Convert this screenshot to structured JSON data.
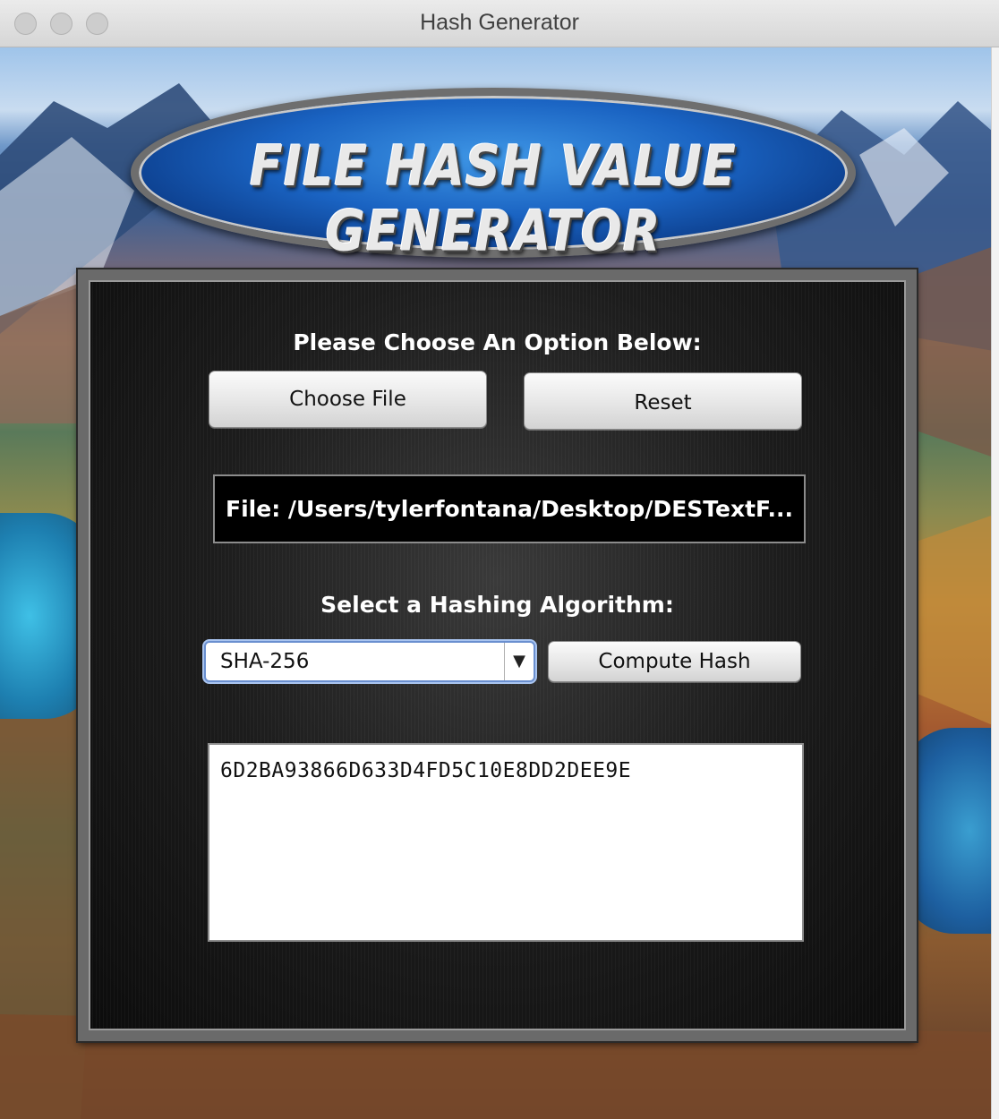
{
  "window": {
    "title": "Hash Generator"
  },
  "logo": {
    "text": "FILE HASH VALUE GENERATOR"
  },
  "panel": {
    "choose_prompt": "Please Choose An Option Below:",
    "choose_file_label": "Choose File",
    "reset_label": "Reset",
    "file_path": "File: /Users/tylerfontana/Desktop/DESTextF...",
    "algorithm_prompt": "Select a Hashing Algorithm:",
    "algorithm_selected": "SHA-256",
    "compute_label": "Compute Hash",
    "hash_output": "6D2BA93866D633D4FD5C10E8DD2DEE9E"
  },
  "colors": {
    "panel_bg": "#1c1c1c",
    "logo_blue": "#1a63c2",
    "select_focus": "#6a8fcf"
  },
  "icons": {
    "dropdown": "chevron-down-icon"
  }
}
